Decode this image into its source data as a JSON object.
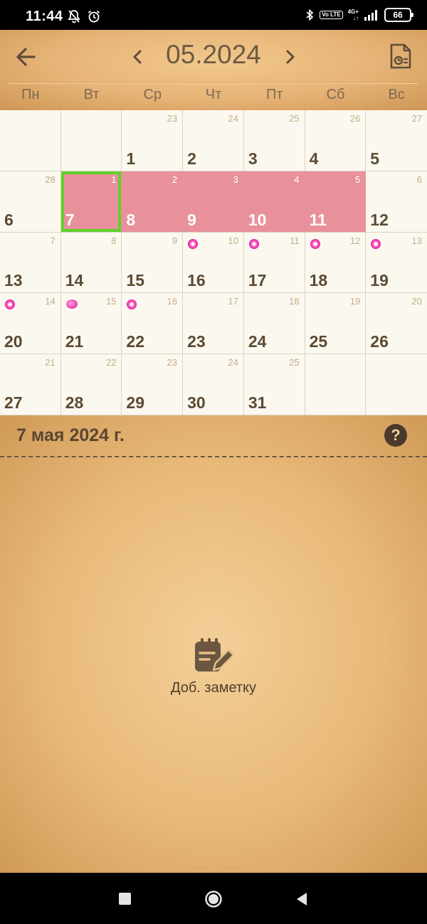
{
  "status": {
    "time": "11:44",
    "volte": "Vo LTE",
    "net_top": "4G+",
    "net_bottom": "↓↑",
    "battery": "66"
  },
  "header": {
    "month_title": "05.2024",
    "weekdays": [
      "Пн",
      "Вт",
      "Ср",
      "Чт",
      "Пт",
      "Сб",
      "Вс"
    ]
  },
  "calendar": {
    "weeks": [
      [
        {
          "day": "",
          "small": ""
        },
        {
          "day": "",
          "small": ""
        },
        {
          "day": "1",
          "small": "23"
        },
        {
          "day": "2",
          "small": "24"
        },
        {
          "day": "3",
          "small": "25"
        },
        {
          "day": "4",
          "small": "26"
        },
        {
          "day": "5",
          "small": "27"
        }
      ],
      [
        {
          "day": "6",
          "small": "28"
        },
        {
          "day": "7",
          "small": "1",
          "period": true,
          "selected": true
        },
        {
          "day": "8",
          "small": "2",
          "period": true
        },
        {
          "day": "9",
          "small": "3",
          "period": true
        },
        {
          "day": "10",
          "small": "4",
          "period": true
        },
        {
          "day": "11",
          "small": "5",
          "period": true
        },
        {
          "day": "12",
          "small": "6"
        }
      ],
      [
        {
          "day": "13",
          "small": "7"
        },
        {
          "day": "14",
          "small": "8"
        },
        {
          "day": "15",
          "small": "9"
        },
        {
          "day": "16",
          "small": "10",
          "icon": "fertile-flower-icon"
        },
        {
          "day": "17",
          "small": "11",
          "icon": "fertile-flower-icon"
        },
        {
          "day": "18",
          "small": "12",
          "icon": "fertile-flower-icon"
        },
        {
          "day": "19",
          "small": "13",
          "icon": "fertile-flower-icon"
        }
      ],
      [
        {
          "day": "20",
          "small": "14",
          "icon": "fertile-flower-icon"
        },
        {
          "day": "21",
          "small": "15",
          "icon": "ovulation-petal-icon"
        },
        {
          "day": "22",
          "small": "16",
          "icon": "fertile-flower-icon"
        },
        {
          "day": "23",
          "small": "17"
        },
        {
          "day": "24",
          "small": "18"
        },
        {
          "day": "25",
          "small": "19"
        },
        {
          "day": "26",
          "small": "20"
        }
      ],
      [
        {
          "day": "27",
          "small": "21"
        },
        {
          "day": "28",
          "small": "22"
        },
        {
          "day": "29",
          "small": "23"
        },
        {
          "day": "30",
          "small": "24"
        },
        {
          "day": "31",
          "small": "25"
        },
        {
          "day": "",
          "small": ""
        },
        {
          "day": "",
          "small": ""
        }
      ]
    ]
  },
  "selected_date": {
    "title": "7 мая 2024 г.",
    "help": "?"
  },
  "notes": {
    "add_label": "Доб. заметку"
  },
  "colors": {
    "period": "#e8919a",
    "selected_border": "#5ed12a",
    "fertile": "#e21aa4",
    "text_brown": "#5c4a33"
  }
}
